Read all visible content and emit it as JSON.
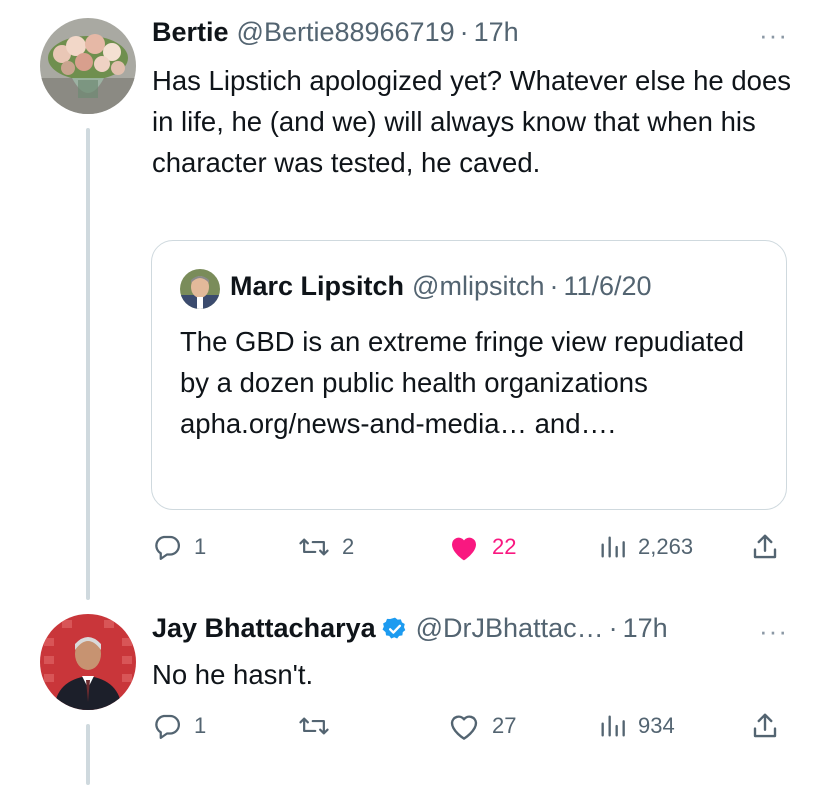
{
  "tweets": [
    {
      "name": "Bertie",
      "handle": "@Bertie88966719",
      "separator": "·",
      "time": "17h",
      "more": "···",
      "text": "Has Lipstich apologized yet? Whatever else he does in life, he (and we) will always know that when his character was tested, he caved.",
      "quote": {
        "name": "Marc Lipsitch",
        "handle": "@mlipsitch",
        "separator": "·",
        "date": "11/6/20",
        "text": "The GBD is an extreme fringe view repudiated by a dozen public health organizations apha.org/news-and-media… and…."
      },
      "actions": {
        "replies": "1",
        "retweets": "2",
        "likes": "22",
        "views": "2,263",
        "liked": true
      }
    },
    {
      "name": "Jay Bhattacharya",
      "verified": true,
      "handle": "@DrJBhattac…",
      "separator": "·",
      "time": "17h",
      "more": "···",
      "text": "No he hasn't.",
      "actions": {
        "replies": "1",
        "retweets": "",
        "likes": "27",
        "views": "934",
        "liked": false
      }
    }
  ],
  "colors": {
    "text": "#0f1419",
    "secondary": "#536471",
    "like": "#f91880",
    "verified": "#1d9bf0",
    "border": "#cfd9de"
  },
  "icons": [
    "reply-icon",
    "retweet-icon",
    "like-icon",
    "views-icon",
    "share-icon",
    "verified-icon",
    "more-icon"
  ]
}
